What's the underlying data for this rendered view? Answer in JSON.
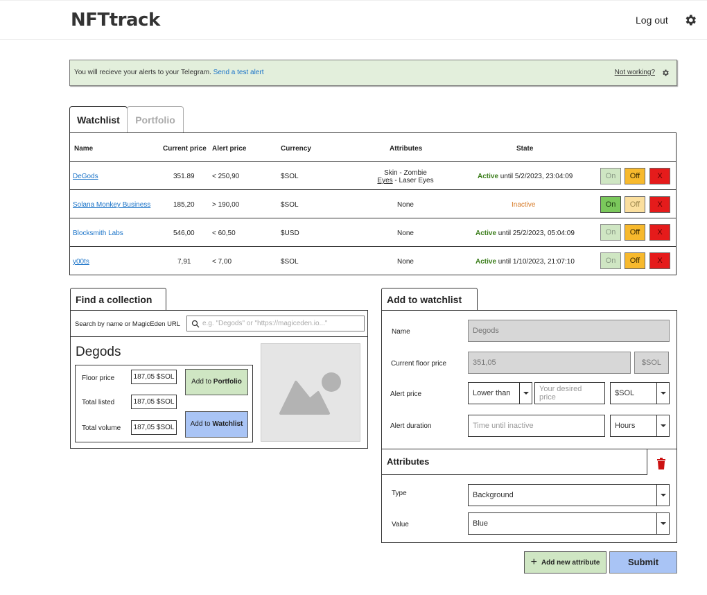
{
  "header": {
    "brand": "NFTtrack",
    "logout_label": "Log out"
  },
  "alert": {
    "message": "You will recieve your alerts to your Telegram.",
    "test_link": "Send a test alert",
    "not_working": "Not working?"
  },
  "tabs": {
    "watchlist": "Watchlist",
    "portfolio": "Portfolio"
  },
  "table": {
    "headers": {
      "name": "Name",
      "current_price": "Current price",
      "alert_price": "Alert price",
      "currency": "Currency",
      "attributes": "Attributes",
      "state": "State"
    },
    "rows": [
      {
        "name": "DeGods",
        "current_price": "351.89",
        "alert_price": "< 250,90",
        "currency": "$SOL",
        "attr_line1": "Skin - Zombie",
        "attr_line2_key": "Eyes",
        "attr_line2_val": " - Laser Eyes",
        "state_word": "Active",
        "state_rest": " until 5/2/2023, 23:04:09",
        "on": "On",
        "off": "Off",
        "x": "X"
      },
      {
        "name": "Solana Monkey Business",
        "current_price": "185,20",
        "alert_price": "> 190,00",
        "currency": "$SOL",
        "attributes": "None",
        "state_word": "Inactive",
        "on": "On",
        "off": "Off",
        "x": "X"
      },
      {
        "name": "Blocksmith Labs",
        "current_price": "546,00",
        "alert_price": "< 60,50",
        "currency": "$USD",
        "attributes": "None",
        "state_word": "Active",
        "state_rest": " until 25/2/2023, 05:04:09",
        "on": "On",
        "off": "Off",
        "x": "X"
      },
      {
        "name": "y00ts",
        "current_price": "7,91",
        "alert_price": "< 7,00",
        "currency": "$SOL",
        "attributes": "None",
        "state_word": "Active",
        "state_rest": " until 1/10/2023, 21:07:10",
        "on": "On",
        "off": "Off",
        "x": "X"
      }
    ]
  },
  "find": {
    "title": "Find a collection",
    "search_label": "Search by name or MagicEden URL",
    "search_placeholder": "e.g. \"Degods\" or \"https://magiceden.io...\"",
    "result_name": "Degods",
    "floor_label": "Floor price",
    "floor_value": "187,05 $SOL",
    "listed_label": "Total listed",
    "listed_value": "187,05 $SOL",
    "volume_label": "Total volume",
    "volume_value": "187,05 $SOL",
    "add_portfolio_prefix": "Add to ",
    "add_portfolio_bold": "Portfolio",
    "add_watchlist_prefix": "Add to ",
    "add_watchlist_bold": "Watchlist"
  },
  "add": {
    "title": "Add to watchlist",
    "name_label": "Name",
    "name_value": "Degods",
    "floor_label": "Current floor price",
    "floor_value": "351,05",
    "floor_currency": "$SOL",
    "alert_label": "Alert price",
    "alert_mode": "Lower than",
    "alert_placeholder": "Your desired price",
    "alert_currency": "$SOL",
    "duration_label": "Alert duration",
    "duration_placeholder": "Time until inactive",
    "duration_unit": "Hours",
    "attributes_title": "Attributes",
    "type_label": "Type",
    "type_value": "Background",
    "value_label": "Value",
    "value_value": "Blue",
    "add_attr_label": "Add new attribute",
    "submit_label": "Submit"
  },
  "colors": {
    "alert_bg": "#e3efdc",
    "active_green": "#3a7d1a",
    "inactive_orange": "#d77c2a",
    "link_blue": "#1a73c8",
    "submit_blue": "#a9c4f5",
    "add_green": "#cfe6c3"
  }
}
